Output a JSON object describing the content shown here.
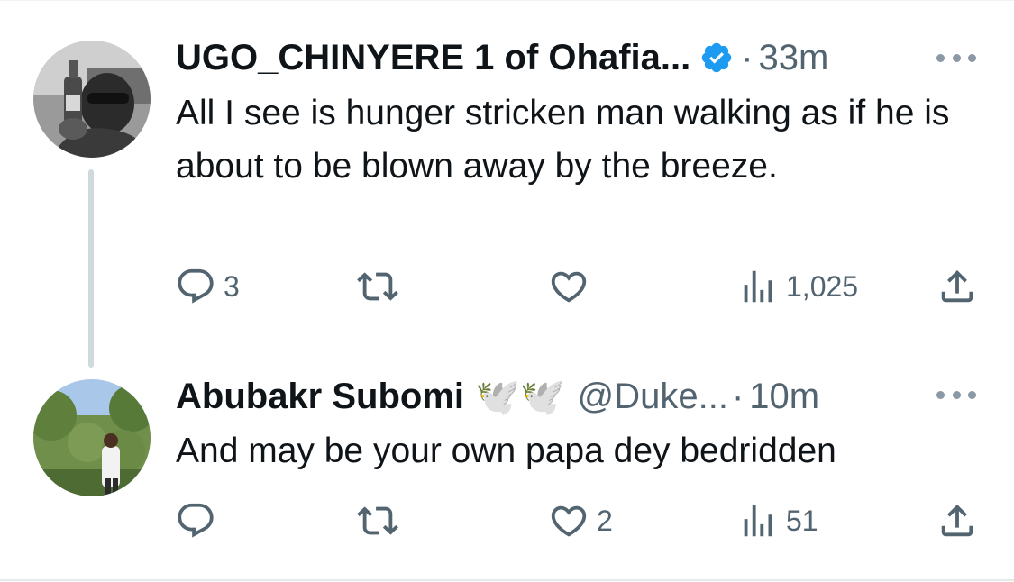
{
  "colors": {
    "text": "#0f1419",
    "secondary": "#536471",
    "verified": "#1d9bf0",
    "thread_line": "#cfd9de"
  },
  "tweets": [
    {
      "author": "UGO_CHINYERE 1 of Ohafia...",
      "verified": true,
      "separator": "·",
      "time": "33m",
      "text": "All I see is hunger stricken man walking as if he is about to be blown away by the breeze.",
      "replies": "3",
      "retweets": "",
      "likes": "",
      "views": "1,025",
      "icons": [
        "reply-icon",
        "retweet-icon",
        "like-icon",
        "views-icon",
        "share-icon"
      ]
    },
    {
      "author": "Abubakr Subomi",
      "emoji": "🕊️🕊️",
      "handle": "@Duke...",
      "separator": "·",
      "time": "10m",
      "text": "And may be your own papa dey bedridden",
      "replies": "",
      "retweets": "",
      "likes": "2",
      "views": "51",
      "icons": [
        "reply-icon",
        "retweet-icon",
        "like-icon",
        "views-icon",
        "share-icon"
      ]
    }
  ]
}
